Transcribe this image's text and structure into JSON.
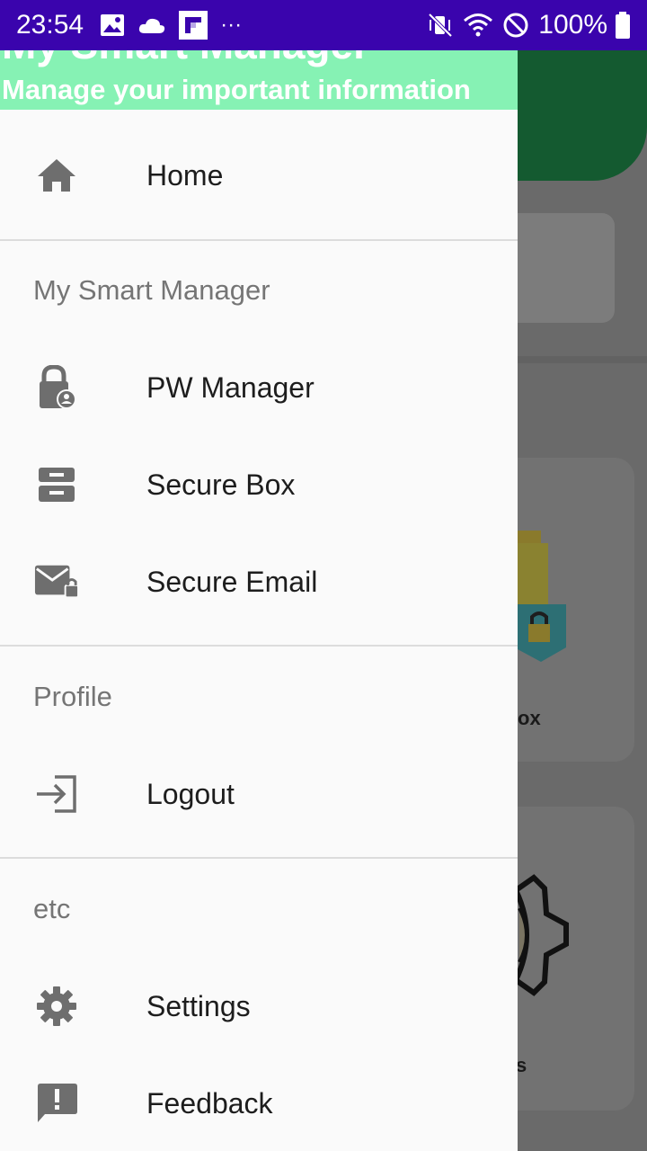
{
  "status_bar": {
    "time": "23:54",
    "battery": "100%",
    "left_icons": [
      "image-icon",
      "cloud-icon",
      "flipboard-icon",
      "more-dots-icon"
    ],
    "right_icons": [
      "vibrate-mute-icon",
      "wifi-icon",
      "do-not-disturb-icon",
      "battery-icon"
    ],
    "overflow_dots": "···"
  },
  "drawer": {
    "header": {
      "title": "My Smart Manager",
      "subtitle": "Manage your important information"
    },
    "items": {
      "home": {
        "label": "Home",
        "icon": "home-icon"
      },
      "pw_manager": {
        "label": "PW Manager",
        "icon": "lock-person-icon"
      },
      "secure_box": {
        "label": "Secure Box",
        "icon": "inbox-tray-icon"
      },
      "secure_email": {
        "label": "Secure Email",
        "icon": "mail-lock-icon"
      },
      "logout": {
        "label": "Logout",
        "icon": "logout-icon"
      },
      "settings": {
        "label": "Settings",
        "icon": "gear-icon"
      },
      "feedback": {
        "label": "Feedback",
        "icon": "feedback-icon"
      }
    },
    "sections": {
      "my_smart_manager": "My Smart Manager",
      "profile": "Profile",
      "etc": "etc"
    }
  },
  "background": {
    "card_box_label": "ox",
    "card_settings_label": "s"
  },
  "colors": {
    "status_bar": "#3a04ad",
    "drawer_header": "#86f2b4",
    "background_green": "#145a30",
    "icon_gray": "#6e6e6e"
  }
}
